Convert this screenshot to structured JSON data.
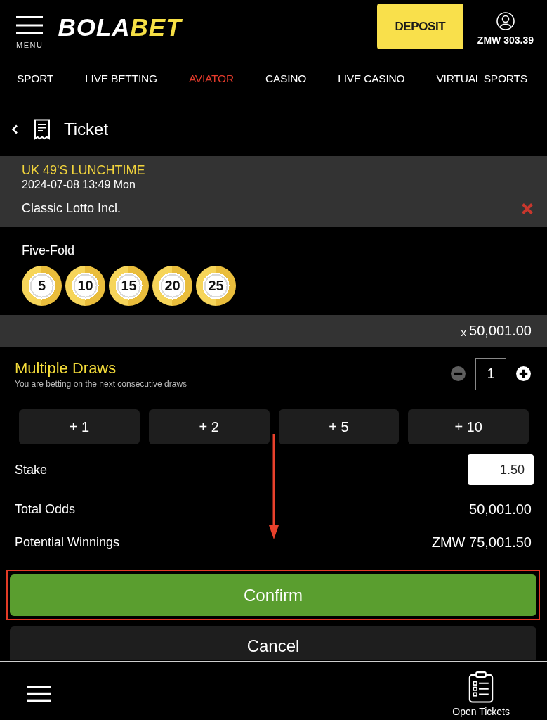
{
  "header": {
    "menu_label": "MENU",
    "logo": {
      "prefix": "BOLA",
      "suffix": "BET"
    },
    "deposit_button": "DEPOSIT",
    "balance": "ZMW 303.39"
  },
  "nav": [
    {
      "label": "SPORT",
      "selected": false
    },
    {
      "label": "LIVE BETTING",
      "selected": false
    },
    {
      "label": "AVIATOR",
      "selected": true
    },
    {
      "label": "CASINO",
      "selected": false
    },
    {
      "label": "LIVE CASINO",
      "selected": false
    },
    {
      "label": "VIRTUAL SPORTS",
      "selected": false
    }
  ],
  "ticket": {
    "title": "Ticket"
  },
  "event": {
    "name": "UK 49'S LUNCHTIME",
    "datetime": "2024-07-08 13:49 Mon",
    "bet_type": "Classic Lotto Incl."
  },
  "selection": {
    "label": "Five-Fold",
    "numbers": [
      "5",
      "10",
      "15",
      "20",
      "25"
    ]
  },
  "odds_bar": {
    "prefix": "x",
    "value": "50,001.00"
  },
  "multiple_draws": {
    "title": "Multiple Draws",
    "subtitle": "You are betting on the next consecutive draws",
    "count": "1",
    "decrement_disabled": true
  },
  "quick_add": [
    "+ 1",
    "+ 2",
    "+ 5",
    "+ 10"
  ],
  "summary": [
    {
      "kind": "input",
      "label": "Stake",
      "value": "1.50"
    },
    {
      "kind": "text",
      "label": "Total Odds",
      "value": "50,001.00"
    },
    {
      "kind": "text",
      "label": "Potential Winnings",
      "value": "ZMW 75,001.50"
    }
  ],
  "actions": [
    {
      "kind": "primary",
      "label": "Confirm",
      "highlighted": true
    },
    {
      "kind": "secondary",
      "label": "Cancel",
      "highlighted": false
    }
  ],
  "bottom_bar": {
    "open_tickets": "Open Tickets"
  }
}
